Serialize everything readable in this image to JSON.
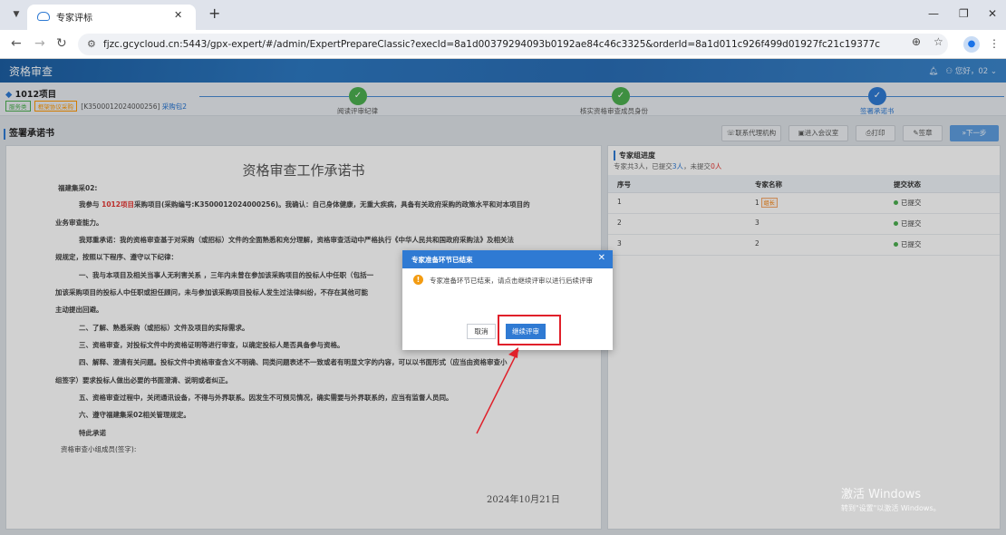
{
  "browser": {
    "tab_title": "专家评标",
    "url": "fjzc.gcycloud.cn:5443/gpx-expert/#/admin/ExpertPrepareClassic?execId=8a1d00379294093b0192ae84c46c3325&orderId=8a1d011c926f499d01927fc21c19377c"
  },
  "header": {
    "app_title": "资格审查",
    "user_text": "您好，02"
  },
  "project": {
    "name": "1012项目",
    "tag1": "服务类",
    "tag2": "框架协议采购",
    "code": "[K3500012024000256]",
    "package": "采购包2"
  },
  "steps": [
    {
      "label": "阅读评审纪律"
    },
    {
      "label": "核实资格审查成员身份"
    },
    {
      "label": "签署承诺书"
    }
  ],
  "toolbar": {
    "section_title": "签署承诺书",
    "btn_contact": "联系代理机构",
    "btn_meeting": "进入会议室",
    "btn_print": "打印",
    "btn_sign": "签章",
    "btn_next": "下一步"
  },
  "document": {
    "title": "资格审查工作承诺书",
    "line1": "福建集采02:",
    "line2a": "我参与 ",
    "line2_project": "1012项目",
    "line2b": "采购项目(采购编号:K3500012024000256)。我确认：自己身体健康，无重大疾病，具备有关政府采购的政策水平和对本项目的",
    "line3": "业务审查能力。",
    "line4": "我郑重承诺：我的资格审查基于对采购（或招标）文件的全面熟悉和充分理解，资格审查活动中严格执行《中华人民共和国政府采购法》及相关法",
    "line5": "规规定，按照以下程序、遵守以下纪律：",
    "line6": "一、我与本项目及相关当事人无利害关系 ，三年内未曾在参加该采购项目的投标人中任职（包括一",
    "line7": "加该采购项目的投标人中任职或担任顾问，未与参加该采购项目投标人发生过法律纠纷，不存在其他可能",
    "line8": "主动提出回避。",
    "line9": "二、了解、熟悉采购（或招标）文件及项目的实际需求。",
    "line10": "三、资格审查，对投标文件中的资格证明等进行审查，以确定投标人是否具备参与资格。",
    "line11": "四、解释、澄清有关问题。投标文件中资格审查含义不明确、同类问题表述不一致或者有明显文字的内容，可以以书面形式（应当由资格审查小",
    "line12": "组签字）要求投标人做出必要的书面澄清、说明或者纠正。",
    "line13": "五、资格审查过程中，关闭通讯设备，不得与外界联系。因发生不可预见情况，确实需要与外界联系的，应当有监督人员同。",
    "line14": "六、遵守福建集采02相关管理规定。",
    "line15": "特此承诺",
    "line16": "资格审查小组成员(签字):",
    "date": "2024年10月21日"
  },
  "progress": {
    "title": "专家组进度",
    "summary_a": "专家共",
    "total": "3人",
    "summary_b": "，已提交",
    "submitted": "3人",
    "summary_c": "，未提交",
    "pending": "0人",
    "columns": [
      "序号",
      "专家名称",
      "提交状态"
    ],
    "rows": [
      {
        "no": "1",
        "name": "1",
        "leader": "组长",
        "status": "已提交"
      },
      {
        "no": "2",
        "name": "3",
        "leader": "",
        "status": "已提交"
      },
      {
        "no": "3",
        "name": "2",
        "leader": "",
        "status": "已提交"
      }
    ]
  },
  "modal": {
    "title": "专家准备环节已结束",
    "message": "专家准备环节已结束，请点击继续评审以进行后续评审",
    "cancel": "取消",
    "confirm": "继续评审"
  },
  "watermark": {
    "line1": "激活 Windows",
    "line2": "转到\"设置\"以激活 Windows。"
  },
  "colors": {
    "primary": "#2f7ad3",
    "success": "#4caf50",
    "warning": "#f39c12",
    "highlight": "#e0202a"
  }
}
